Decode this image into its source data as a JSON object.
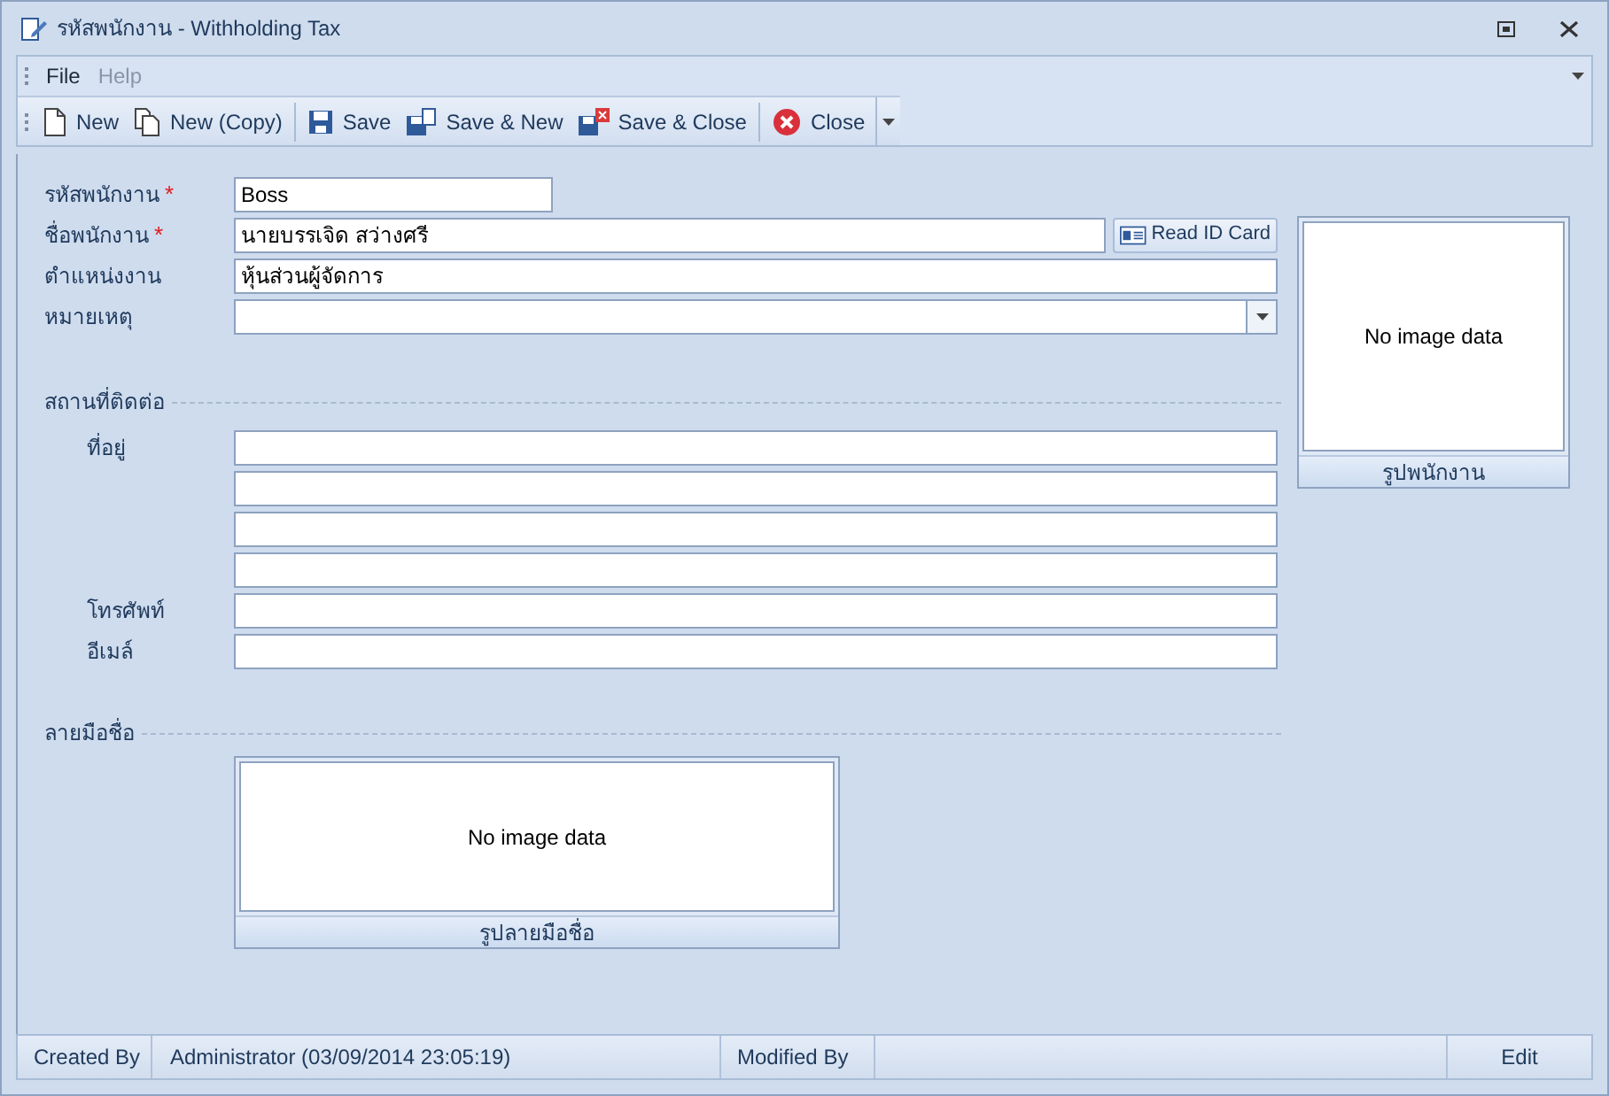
{
  "window": {
    "title": "รหัสพนักงาน - Withholding Tax"
  },
  "menu": [
    {
      "label": "File",
      "disabled": false
    },
    {
      "label": "Help",
      "disabled": true
    }
  ],
  "toolbar": {
    "groups": [
      {
        "items": [
          {
            "kind": "new",
            "label": "New"
          },
          {
            "kind": "copy",
            "label": "New (Copy)"
          }
        ]
      },
      {
        "items": [
          {
            "kind": "save",
            "label": "Save"
          },
          {
            "kind": "save_new",
            "label": "Save & New"
          },
          {
            "kind": "save_close",
            "label": "Save & Close"
          }
        ]
      },
      {
        "items": [
          {
            "kind": "close",
            "label": "Close"
          }
        ]
      }
    ]
  },
  "form": {
    "fields": [
      {
        "kind": "short",
        "label": "รหัสพนักงาน",
        "required_mark": "*",
        "value": "Boss"
      },
      {
        "kind": "with_button",
        "label": "ชื่อพนักงาน",
        "required_mark": "*",
        "value": "นายบรรเจิด สว่างศรี",
        "button": "Read ID Card"
      },
      {
        "kind": "text",
        "label": "ตำแหน่งงาน",
        "value": "หุ้นส่วนผู้จัดการ"
      },
      {
        "kind": "combo",
        "label": "หมายเหตุ"
      }
    ],
    "photo": {
      "text": "No image data",
      "caption": "รูปพนักงาน"
    }
  },
  "contact": {
    "title": "สถานที่ติดต่อ",
    "rows": [
      {
        "kind": "labelled",
        "label": "ที่อยู่"
      },
      {
        "kind": "continuation"
      },
      {
        "kind": "continuation"
      },
      {
        "kind": "continuation"
      },
      {
        "kind": "labelled",
        "label": "โทรศัพท์"
      },
      {
        "kind": "labelled",
        "label": "อีเมล์"
      }
    ]
  },
  "signature": {
    "title": "ลายมือชื่อ",
    "text": "No image data",
    "caption": "รูปลายมือชื่อ"
  },
  "status_bar": {
    "created_label": "Created By",
    "created_value": "Administrator (03/09/2014 23:05:19)",
    "modified_label": "Modified By",
    "mode": "Edit"
  }
}
